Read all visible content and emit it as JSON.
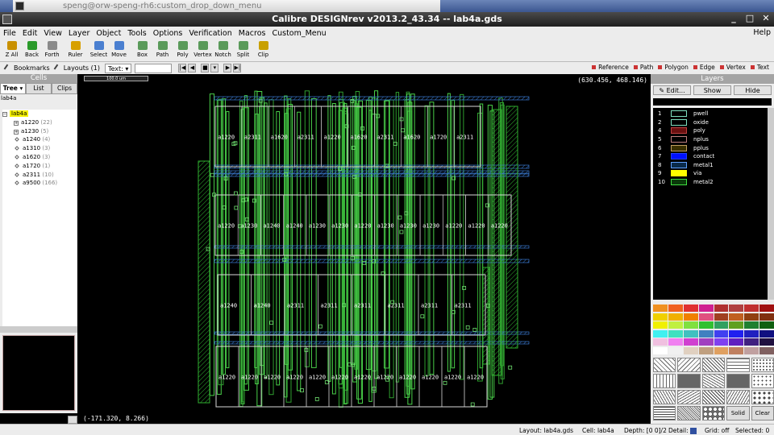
{
  "desktop": {
    "terminal_title": "speng@orw-speng-rh6:custom_drop_down_menu"
  },
  "window": {
    "title": "Calibre DESIGNrev v2013.2_43.34  --  lab4a.gds"
  },
  "menubar": {
    "items": [
      "File",
      "Edit",
      "View",
      "Layer",
      "Object",
      "Tools",
      "Options",
      "Verification",
      "Macros",
      "Custom_Menu"
    ],
    "help": "Help"
  },
  "toolbar": {
    "tools": [
      {
        "label": "Z All",
        "icon": "zoom-all-icon",
        "color": "#c89000"
      },
      {
        "label": "Back",
        "icon": "back-arrow-icon",
        "color": "#2a9a2a"
      },
      {
        "label": "Forth",
        "icon": "forth-arrow-icon",
        "color": "#8a8a8a"
      },
      {
        "label": "Ruler",
        "icon": "ruler-icon",
        "color": "#d7a000"
      },
      {
        "label": "Select",
        "icon": "select-cursor-icon",
        "color": "#4a7fd0"
      },
      {
        "label": "Move",
        "icon": "move-icon",
        "color": "#4a7fd0"
      },
      {
        "label": "Box",
        "icon": "box-icon",
        "color": "#5a9a5a"
      },
      {
        "label": "Path",
        "icon": "path-icon",
        "color": "#5a9a5a"
      },
      {
        "label": "Poly",
        "icon": "poly-icon",
        "color": "#5a9a5a"
      },
      {
        "label": "Vertex",
        "icon": "vertex-icon",
        "color": "#5a9a5a"
      },
      {
        "label": "Notch",
        "icon": "notch-icon",
        "color": "#5a9a5a"
      },
      {
        "label": "Split",
        "icon": "split-icon",
        "color": "#5a9a5a"
      },
      {
        "label": "Clip",
        "icon": "clip-icon",
        "color": "#c8a000"
      }
    ]
  },
  "toolbar2": {
    "bookmarks": "Bookmarks",
    "layouts": "Layouts (1)",
    "text_combo": "Text",
    "filters": [
      "Reference",
      "Path",
      "Polygon",
      "Edge",
      "Vertex",
      "Text"
    ]
  },
  "cells": {
    "title": "Cells",
    "tabs": [
      "Tree",
      "List",
      "Clips"
    ],
    "path": "lab4a",
    "root": "lab4a",
    "items": [
      {
        "name": "a1220",
        "count": "(22)",
        "expander": "+"
      },
      {
        "name": "a1230",
        "count": "(5)",
        "expander": "+"
      },
      {
        "name": "a1240",
        "count": "(4)",
        "expander": ""
      },
      {
        "name": "a1310",
        "count": "(3)",
        "expander": ""
      },
      {
        "name": "a1620",
        "count": "(3)",
        "expander": ""
      },
      {
        "name": "a1720",
        "count": "(1)",
        "expander": ""
      },
      {
        "name": "a2311",
        "count": "(10)",
        "expander": ""
      },
      {
        "name": "a9500",
        "count": "(166)",
        "expander": ""
      }
    ]
  },
  "canvas": {
    "ruler_label": "100.0 um",
    "coord_top_right": "(630.456, 468.146)",
    "coord_bottom_left": "(-171.320, 8.266)",
    "row1_labels": [
      "a1220",
      "a2311",
      "a1620",
      "a2311",
      "a1220",
      "a1620",
      "a2311",
      "a1620",
      "a1720",
      "a2311"
    ],
    "row2_labels": [
      "a1220",
      "a1230",
      "a1240",
      "a1240",
      "a1230",
      "a1230",
      "a1220",
      "a1230",
      "a1230",
      "a1230",
      "a1220",
      "a1220",
      "a1220"
    ],
    "row3_labels": [
      "a1240",
      "a1240",
      "a2311",
      "a2311",
      "a2311",
      "a2311",
      "a2311",
      "a2311"
    ],
    "row4_labels": [
      "a1220",
      "a1220",
      "a1220",
      "a1220",
      "a1220",
      "a1220",
      "a1220",
      "a1220",
      "a1220",
      "a1220",
      "a1220",
      "a1220"
    ]
  },
  "layers": {
    "title": "Layers",
    "buttons": [
      "Edit...",
      "Show",
      "Hide"
    ],
    "items": [
      {
        "num": "1",
        "name": "pwell",
        "fill": "#000000",
        "border": "#7fe0c0"
      },
      {
        "num": "2",
        "name": "oxide",
        "fill": "#000000",
        "border": "#7fe0c0"
      },
      {
        "num": "4",
        "name": "poly",
        "fill": "#6a1010",
        "border": "#c04040"
      },
      {
        "num": "5",
        "name": "nplus",
        "fill": "#000000",
        "border": "#c08080"
      },
      {
        "num": "6",
        "name": "pplus",
        "fill": "#3a3000",
        "border": "#c0a060"
      },
      {
        "num": "7",
        "name": "contact",
        "fill": "#0010ff",
        "border": "#2040ff"
      },
      {
        "num": "8",
        "name": "metal1",
        "fill": "#0a2a4a",
        "border": "#60a0ff"
      },
      {
        "num": "9",
        "name": "via",
        "fill": "#ffff00",
        "border": "#ffff00"
      },
      {
        "num": "10",
        "name": "metal2",
        "fill": "#0a3a0a",
        "border": "#40e040"
      }
    ],
    "palette": [
      "#f09020",
      "#f06020",
      "#e03030",
      "#d02090",
      "#b03030",
      "#b04040",
      "#c03030",
      "#a01010",
      "#f0d000",
      "#f0b000",
      "#f08000",
      "#e05080",
      "#a04020",
      "#c06020",
      "#904010",
      "#803010",
      "#f0f000",
      "#c0f040",
      "#80e040",
      "#30c030",
      "#30a060",
      "#60a020",
      "#208030",
      "#106010",
      "#40f0f0",
      "#40e0c0",
      "#40c0c0",
      "#4080c0",
      "#4040f0",
      "#2020f0",
      "#2020c0",
      "#101080",
      "#f0c0e0",
      "#f080f0",
      "#d040d0",
      "#a040c0",
      "#8040f0",
      "#6020c0",
      "#402080",
      "#201040",
      "#ffffff",
      "#f0f0f0",
      "#e0d0c0",
      "#c0a080",
      "#e0a060",
      "#c08060",
      "#c0a0a0",
      "#806060"
    ],
    "pattern_labels": [
      "Solid",
      "Clear"
    ]
  },
  "status": {
    "layout_label": "Layout:",
    "layout": "lab4a.gds",
    "cell_label": "Cell:",
    "cell": "lab4a",
    "depth_label": "Depth:",
    "depth": "[0 0]/2",
    "detail_label": "Detail:",
    "grid_label": "Grid:",
    "grid": "off",
    "selected_label": "Selected:",
    "selected": "0"
  }
}
